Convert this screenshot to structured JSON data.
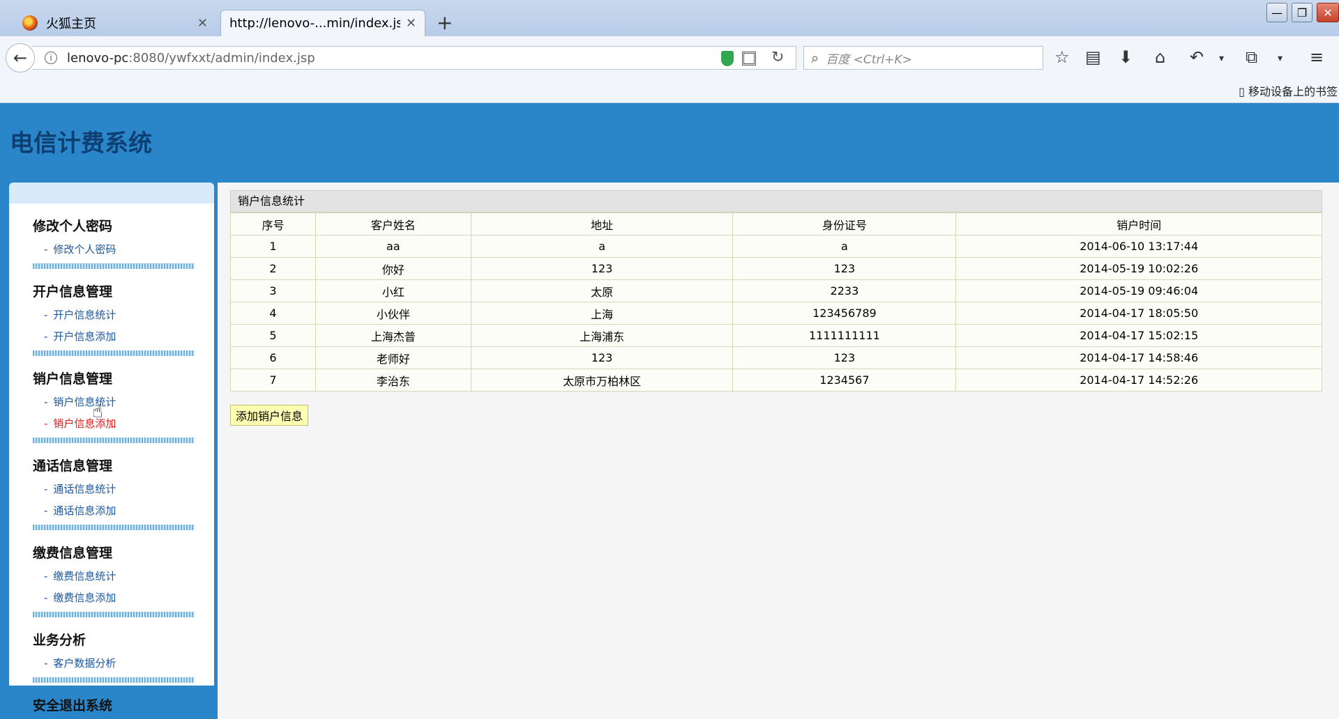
{
  "browser": {
    "tabs": [
      {
        "label": "火狐主页",
        "active": false
      },
      {
        "label": "http://lenovo-...min/index.jsp",
        "active": true
      }
    ],
    "new_tab": "+",
    "url_host": "lenovo-pc",
    "url_path": ":8080/ywfxxt/admin/index.jsp",
    "search_placeholder": "百度 <Ctrl+K>",
    "mobile_bookmarks": "移动设备上的书签",
    "window_buttons": {
      "minimize": "—",
      "maximize": "❐",
      "close": "✕"
    }
  },
  "app": {
    "title": "电信计费系统"
  },
  "sidebar": {
    "groups": [
      {
        "title": "修改个人密码",
        "links": [
          "修改个人密码"
        ]
      },
      {
        "title": "开户信息管理",
        "links": [
          "开户信息统计",
          "开户信息添加"
        ]
      },
      {
        "title": "销户信息管理",
        "links": [
          "销户信息统计",
          "销户信息添加"
        ]
      },
      {
        "title": "通话信息管理",
        "links": [
          "通话信息统计",
          "通话信息添加"
        ]
      },
      {
        "title": "缴费信息管理",
        "links": [
          "缴费信息统计",
          "缴费信息添加"
        ]
      },
      {
        "title": "业务分析",
        "links": [
          "客户数据分析"
        ]
      },
      {
        "title": "安全退出系统",
        "links": [
          "安全退出系统"
        ]
      }
    ],
    "active_link": "销户信息添加",
    "link_prefix": "-"
  },
  "content": {
    "caption": "销户信息统计",
    "columns": [
      "序号",
      "客户姓名",
      "地址",
      "身份证号",
      "销户时间"
    ],
    "rows": [
      [
        "1",
        "aa",
        "a",
        "a",
        "2014-06-10 13:17:44"
      ],
      [
        "2",
        "你好",
        "123",
        "123",
        "2014-05-19 10:02:26"
      ],
      [
        "3",
        "小红",
        "太原",
        "2233",
        "2014-05-19 09:46:04"
      ],
      [
        "4",
        "小伙伴",
        "上海",
        "123456789",
        "2014-04-17 18:05:50"
      ],
      [
        "5",
        "上海杰普",
        "上海浦东",
        "1111111111",
        "2014-04-17 15:02:15"
      ],
      [
        "6",
        "老师好",
        "123",
        "123",
        "2014-04-17 14:58:46"
      ],
      [
        "7",
        "李治东",
        "太原市万柏林区",
        "1234567",
        "2014-04-17 14:52:26"
      ]
    ],
    "add_button": "添加销户信息"
  },
  "colors": {
    "header_bg": "#2a86c8",
    "title_color": "#0d3f73",
    "link_color": "#1b57a0",
    "active_link_color": "#e01818"
  }
}
